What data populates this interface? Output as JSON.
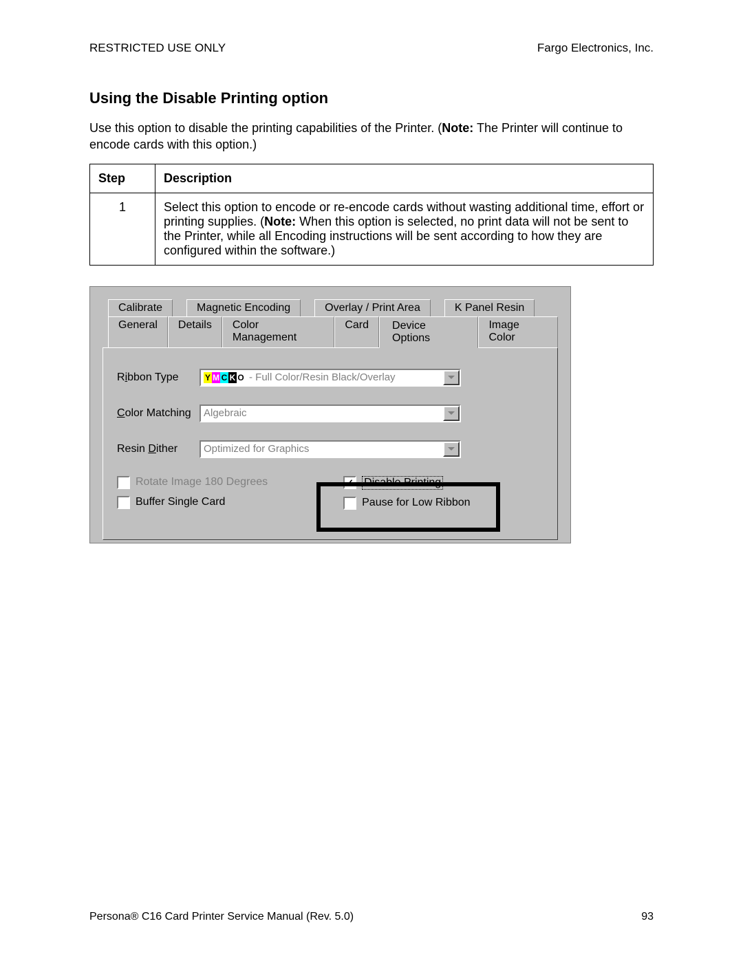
{
  "header": {
    "left": "RESTRICTED USE ONLY",
    "right": "Fargo Electronics, Inc."
  },
  "section_title": "Using the Disable Printing option",
  "intro_pre": "Use this option to disable the printing capabilities of the Printer. (",
  "intro_note_label": "Note:",
  "intro_post": "  The Printer will continue to encode cards with this option.)",
  "table": {
    "head_step": "Step",
    "head_desc": "Description",
    "row1_step": "1",
    "row1_pre": "Select this option to encode or re-encode cards without wasting additional time, effort or printing supplies. (",
    "row1_note_label": "Note:",
    "row1_post": "  When this option is selected, no print data will not be sent to the Printer, while all Encoding instructions will be sent according to how they are configured within the software.)"
  },
  "dialog": {
    "tabs_row1": {
      "calibrate": "Calibrate",
      "magnetic": "Magnetic Encoding",
      "overlay": "Overlay / Print Area",
      "kpanel": "K Panel Resin"
    },
    "tabs_row2": {
      "general": "General",
      "details": "Details",
      "colormgmt": "Color Management",
      "card": "Card",
      "device": "Device Options",
      "imagecolor": "Image Color"
    },
    "labels": {
      "ribbon_pre": "R",
      "ribbon_ul": "i",
      "ribbon_post": "bbon Type",
      "color_ul": "C",
      "color_post": "olor Matching",
      "resin_pre": "Resin ",
      "resin_ul": "D",
      "resin_post": "ither"
    },
    "values": {
      "ribbon": " - Full Color/Resin Black/Overlay",
      "color": "Algebraic",
      "resin": "Optimized for Graphics"
    },
    "checks": {
      "rotate_pre": "Ro",
      "rotate_ul": "t",
      "rotate_post": "ate Image 180 Degrees",
      "buffer_pre": "Bu",
      "buffer_ul": "f",
      "buffer_post": "fer Single Card",
      "disable_ul": "D",
      "disable_post": "isable Printing",
      "pause_ul": "P",
      "pause_post": "ause for Low Ribbon"
    }
  },
  "footer": {
    "left_pre": "Persona",
    "left_post": " C16 Card Printer Service Manual (Rev. 5.0)",
    "right": "93"
  }
}
